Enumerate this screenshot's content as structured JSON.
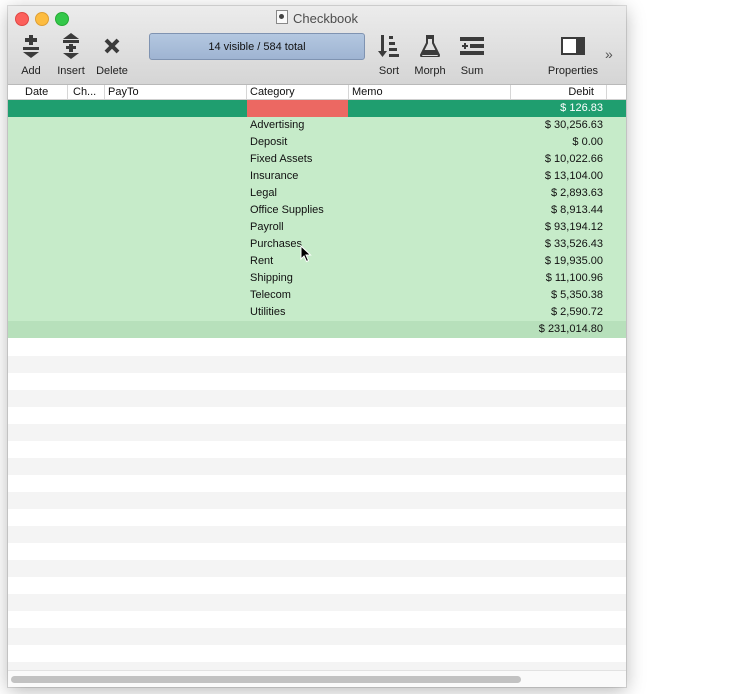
{
  "window": {
    "title": "Checkbook"
  },
  "toolbar": {
    "add_label": "Add",
    "insert_label": "Insert",
    "delete_label": "Delete",
    "status_text": "14 visible / 584 total",
    "sort_label": "Sort",
    "morph_label": "Morph",
    "sum_label": "Sum",
    "properties_label": "Properties",
    "overflow_glyph": "»"
  },
  "columns": {
    "date": "Date",
    "check": "Ch...",
    "payto": "PayTo",
    "category": "Category",
    "memo": "Memo",
    "debit": "Debit"
  },
  "selected_row": {
    "debit": "$ 126.83"
  },
  "rows": [
    {
      "category": "Advertising",
      "debit": "$ 30,256.63"
    },
    {
      "category": "Deposit",
      "debit": "$ 0.00"
    },
    {
      "category": "Fixed Assets",
      "debit": "$ 10,022.66"
    },
    {
      "category": "Insurance",
      "debit": "$ 13,104.00"
    },
    {
      "category": "Legal",
      "debit": "$ 2,893.63"
    },
    {
      "category": "Office Supplies",
      "debit": "$ 8,913.44"
    },
    {
      "category": "Payroll",
      "debit": "$ 93,194.12"
    },
    {
      "category": "Purchases",
      "debit": "$ 33,526.43"
    },
    {
      "category": "Rent",
      "debit": "$ 19,935.00"
    },
    {
      "category": "Shipping",
      "debit": "$ 11,100.96"
    },
    {
      "category": "Telecom",
      "debit": "$ 5,350.38"
    },
    {
      "category": "Utilities",
      "debit": "$ 2,590.72"
    }
  ],
  "total": {
    "debit": "$ 231,014.80"
  },
  "colors": {
    "selected_row": "#1f9e6f",
    "selected_category_cell": "#ec6862",
    "group_rows": "#c6ebc9",
    "status_box": "#a9bdd9"
  }
}
